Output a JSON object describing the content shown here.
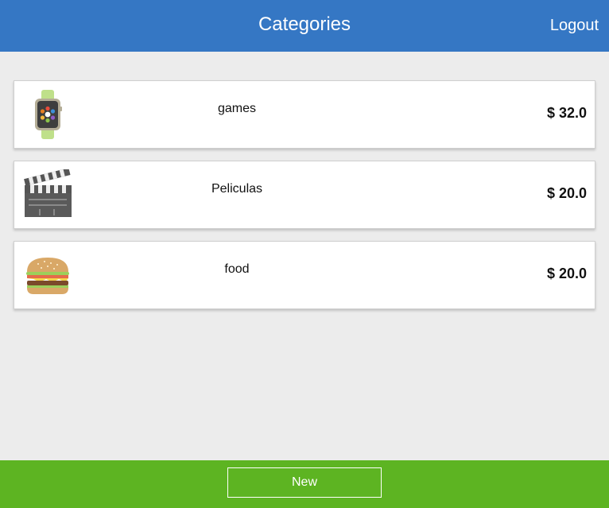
{
  "header": {
    "title": "Categories",
    "logout_label": "Logout"
  },
  "categories": [
    {
      "name": "games",
      "price": "$ 32.0",
      "icon": "smartwatch-icon"
    },
    {
      "name": "Peliculas",
      "price": "$ 20.0",
      "icon": "clapperboard-icon"
    },
    {
      "name": "food",
      "price": "$ 20.0",
      "icon": "burger-icon"
    }
  ],
  "footer": {
    "new_label": "New"
  },
  "colors": {
    "header": "#3577c4",
    "footer": "#5db422",
    "background": "#ececec"
  }
}
